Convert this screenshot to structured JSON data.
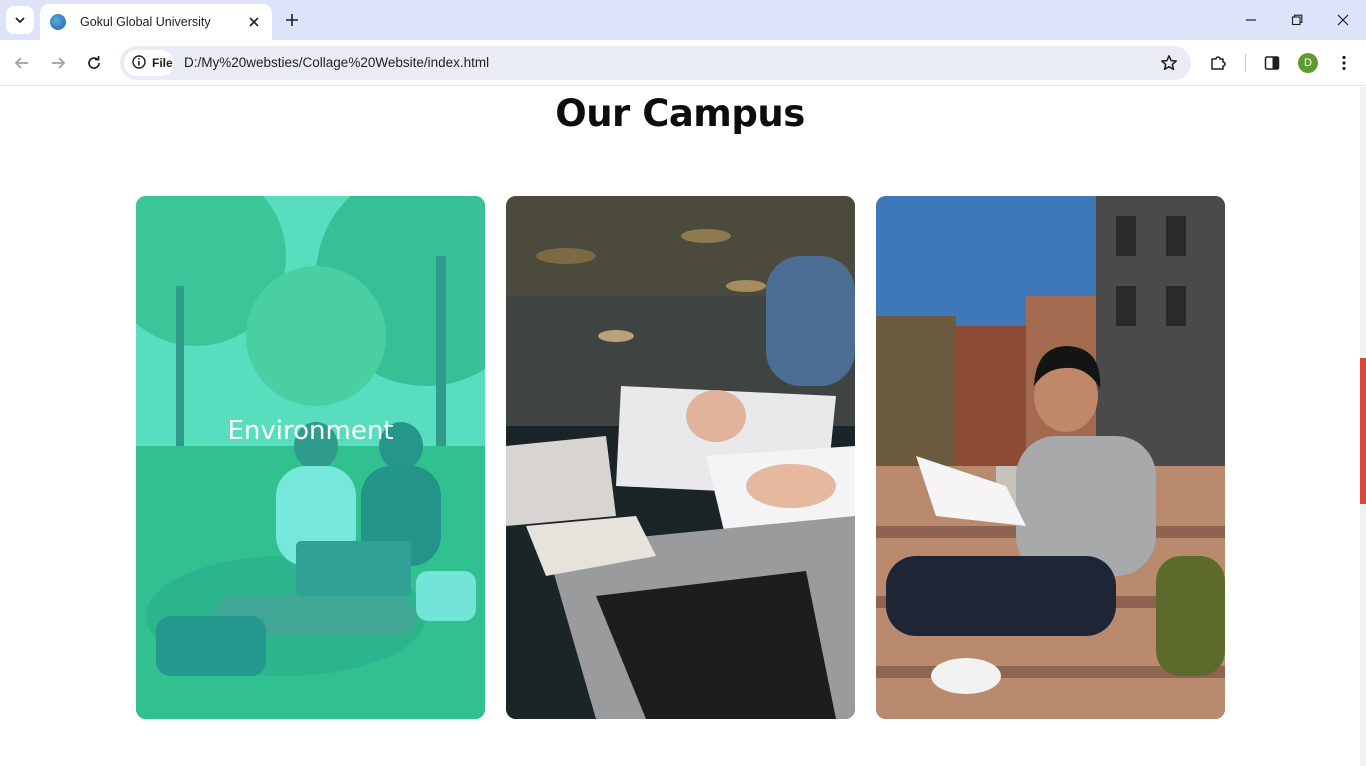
{
  "browser": {
    "tab_title": "Gokul Global University",
    "site_chip": "File",
    "url": "D:/My%20websties/Collage%20Website/index.html",
    "profile_initial": "D",
    "icons": [
      "tab-search-icon",
      "favicon-globe-icon",
      "close-icon",
      "plus-icon",
      "minimize-icon",
      "restore-icon",
      "close-window-icon",
      "back-arrow-icon",
      "forward-arrow-icon",
      "reload-icon",
      "info-icon",
      "star-icon",
      "extensions-puzzle-icon",
      "side-panel-icon",
      "kebab-menu-icon"
    ]
  },
  "page": {
    "section_title": "Our Campus",
    "accent_color": "#28e0cd",
    "cards": [
      {
        "image": "students-with-laptop-on-grass",
        "caption": "Environment",
        "overlay": true
      },
      {
        "image": "hands-writing-notes-beside-laptop",
        "caption": "",
        "overlay": false
      },
      {
        "image": "smiling-student-on-campus-steps",
        "caption": "",
        "overlay": false
      }
    ]
  },
  "colors": {
    "tabstrip": "#dee3f9",
    "omnibox": "#e9ebf5",
    "avatar": "#5f9c2f",
    "scroll_thumb": "#d9463c"
  }
}
